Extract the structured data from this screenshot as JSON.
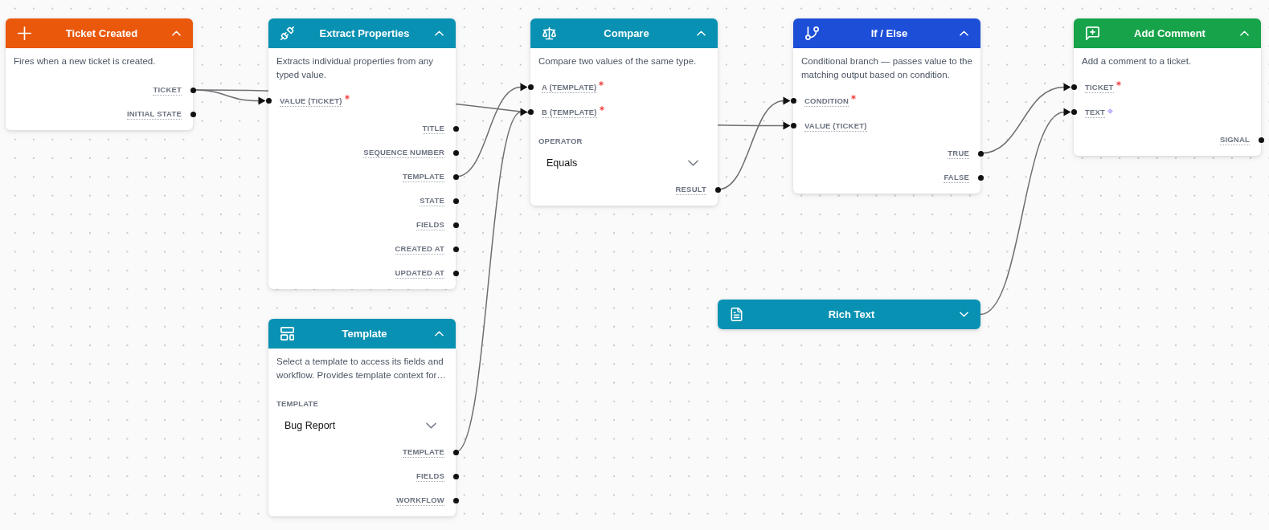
{
  "nodes": [
    {
      "kind": "trigger",
      "title": "Ticket Created",
      "color": "#ea580c",
      "expanded": true,
      "description": "Fires when a new ticket is created.",
      "outputs": [
        {
          "label": "TICKET"
        },
        {
          "label": "INITIAL STATE"
        }
      ]
    },
    {
      "kind": "extract",
      "title": "Extract Properties",
      "color": "#0891b2",
      "expanded": true,
      "description": "Extracts individual properties from any typed value.",
      "inputs": [
        {
          "label": "VALUE (TICKET)",
          "kind": "required"
        }
      ],
      "outputs": [
        {
          "label": "TITLE"
        },
        {
          "label": "SEQUENCE NUMBER"
        },
        {
          "label": "TEMPLATE"
        },
        {
          "label": "STATE"
        },
        {
          "label": "FIELDS"
        },
        {
          "label": "CREATED AT"
        },
        {
          "label": "UPDATED AT"
        }
      ]
    },
    {
      "kind": "compare",
      "title": "Compare",
      "color": "#0891b2",
      "expanded": true,
      "description": "Compare two values of the same type.",
      "inputs": [
        {
          "label": "A (TEMPLATE)",
          "kind": "required"
        },
        {
          "label": "B (TEMPLATE)",
          "kind": "required"
        }
      ],
      "field": {
        "label": "OPERATOR",
        "value": "Equals"
      },
      "outputs": [
        {
          "label": "RESULT"
        }
      ]
    },
    {
      "kind": "condition",
      "title": "If / Else",
      "color": "#1d4ed8",
      "expanded": true,
      "description": "Conditional branch — passes value to the matching output based on condition.",
      "inputs": [
        {
          "label": "CONDITION",
          "kind": "required"
        },
        {
          "label": "VALUE (TICKET)",
          "kind": "plain"
        }
      ],
      "outputs": [
        {
          "label": "TRUE"
        },
        {
          "label": "FALSE"
        }
      ]
    },
    {
      "kind": "action",
      "title": "Add Comment",
      "color": "#16a34a",
      "expanded": true,
      "description": "Add a comment to a ticket.",
      "inputs": [
        {
          "label": "TICKET",
          "kind": "required"
        },
        {
          "label": "TEXT",
          "kind": "diamond"
        }
      ],
      "outputs": [
        {
          "label": "SIGNAL"
        }
      ]
    },
    {
      "kind": "template",
      "title": "Template",
      "color": "#0891b2",
      "expanded": true,
      "description": "Select a template to access its fields and workflow. Provides template context for…",
      "field": {
        "label": "TEMPLATE",
        "value": "Bug Report"
      },
      "outputs": [
        {
          "label": "TEMPLATE"
        },
        {
          "label": "FIELDS"
        },
        {
          "label": "WORKFLOW"
        }
      ]
    },
    {
      "kind": "rich-text",
      "title": "Rich Text",
      "color": "#0891b2",
      "expanded": false
    }
  ]
}
